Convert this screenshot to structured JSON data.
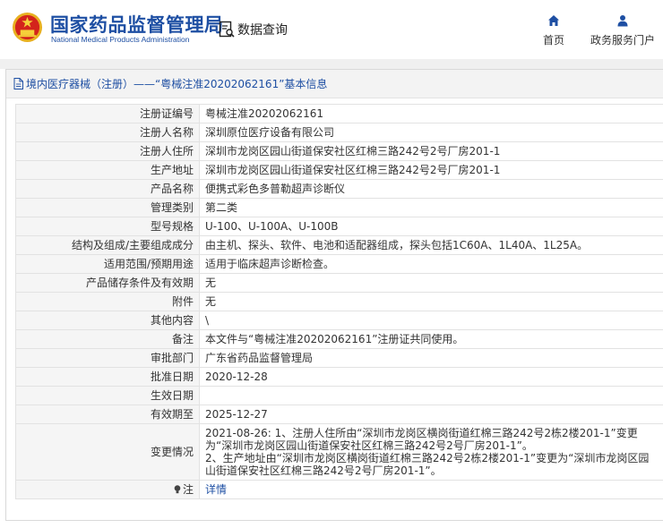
{
  "header": {
    "site_name_cn": "国家药品监督管理局",
    "site_name_en": "National Medical Products Administration",
    "query_label": "数据查询",
    "nav": [
      {
        "label": "首页",
        "icon": "home-icon"
      },
      {
        "label": "政务服务门户",
        "icon": "user-icon"
      }
    ]
  },
  "panel": {
    "title": "境内医疗器械（注册）——“粤械注准20202062161”基本信息"
  },
  "rows": {
    "reg_no": {
      "label": "注册证编号",
      "value": "粤械注准20202062161"
    },
    "registrant": {
      "label": "注册人名称",
      "value": "深圳原位医疗设备有限公司"
    },
    "registrant_address": {
      "label": "注册人住所",
      "value": "深圳市龙岗区园山街道保安社区红棉三路242号2号厂房201-1"
    },
    "production_address": {
      "label": "生产地址",
      "value": "深圳市龙岗区园山街道保安社区红棉三路242号2号厂房201-1"
    },
    "product_name": {
      "label": "产品名称",
      "value": "便携式彩色多普勒超声诊断仪"
    },
    "category": {
      "label": "管理类别",
      "value": "第二类"
    },
    "model": {
      "label": "型号规格",
      "value": "U-100、U-100A、U-100B"
    },
    "structure": {
      "label": "结构及组成/主要组成成分",
      "value": "由主机、探头、软件、电池和适配器组成，探头包括1C60A、1L40A、1L25A。"
    },
    "scope": {
      "label": "适用范围/预期用途",
      "value": "适用于临床超声诊断检查。"
    },
    "storage": {
      "label": "产品储存条件及有效期",
      "value": "无"
    },
    "attachment": {
      "label": "附件",
      "value": "无"
    },
    "other": {
      "label": "其他内容",
      "value": "\\"
    },
    "remark": {
      "label": "备注",
      "value": "本文件与“粤械注准20202062161”注册证共同使用。"
    },
    "approval_dept": {
      "label": "审批部门",
      "value": "广东省药品监督管理局"
    },
    "approval_date": {
      "label": "批准日期",
      "value": "2020-12-28"
    },
    "effective_date": {
      "label": "生效日期",
      "value": ""
    },
    "expiry_date": {
      "label": "有效期至",
      "value": "2025-12-27"
    },
    "changes": {
      "label": "变更情况",
      "lines": [
        "2021-08-26: 1、注册人住所由“深圳市龙岗区横岗街道红棉三路242号2栋2楼201-1”变更",
        "为“深圳市龙岗区园山街道保安社区红棉三路242号2号厂房201-1”。",
        "2、生产地址由“深圳市龙岗区横岗街道红棉三路242号2栋2楼201-1”变更为“深圳市龙岗区园",
        "山街道保安社区红棉三路242号2号厂房201-1”。"
      ]
    },
    "note": {
      "label": "注",
      "value": "详情"
    }
  }
}
